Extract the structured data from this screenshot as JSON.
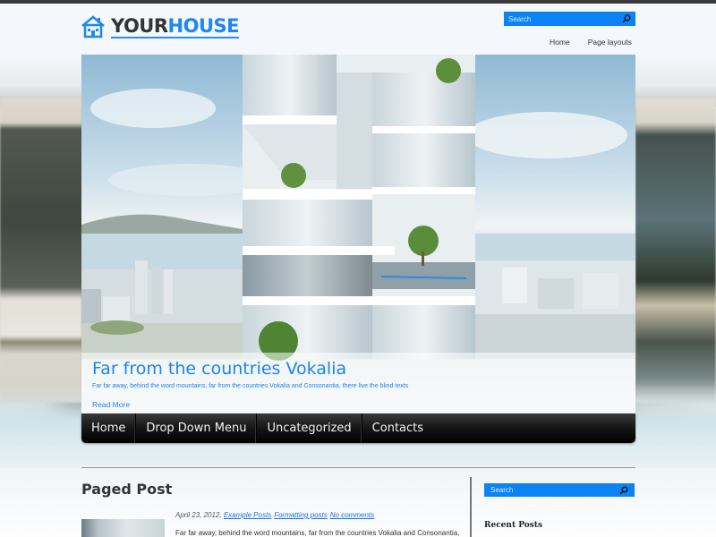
{
  "header": {
    "logo": {
      "part1": "YOUR",
      "part2": "HOUSE",
      "icon": "house-icon"
    },
    "search": {
      "placeholder": "Search",
      "icon": "search-icon"
    },
    "top_nav": [
      {
        "label": "Home"
      },
      {
        "label": "Page layouts"
      }
    ]
  },
  "hero": {
    "title": "Far from the countries Vokalia",
    "text": "Far far away, behind the word mountains, far from the countries Vokalia and Consonantia, there live the blind texts",
    "read_more": "Read More"
  },
  "main_nav": [
    {
      "label": "Home"
    },
    {
      "label": "Drop Down Menu"
    },
    {
      "label": "Uncategorized"
    },
    {
      "label": "Contacts"
    }
  ],
  "content": {
    "post": {
      "title": "Paged Post",
      "date": "April 23, 2012,",
      "categories": [
        "Example Posts",
        "Formatting posts"
      ],
      "comments": "No comments",
      "excerpt": "Far far away, behind the word mountains, far from the countries Vokalia and Consonantia,"
    }
  },
  "sidebar": {
    "search": {
      "placeholder": "Search",
      "icon": "search-icon"
    },
    "recent_posts_title": "Recent Posts"
  },
  "colors": {
    "accent": "#1a85f0",
    "search_bg": "#0c82f5",
    "nav_bg": "#111111"
  }
}
